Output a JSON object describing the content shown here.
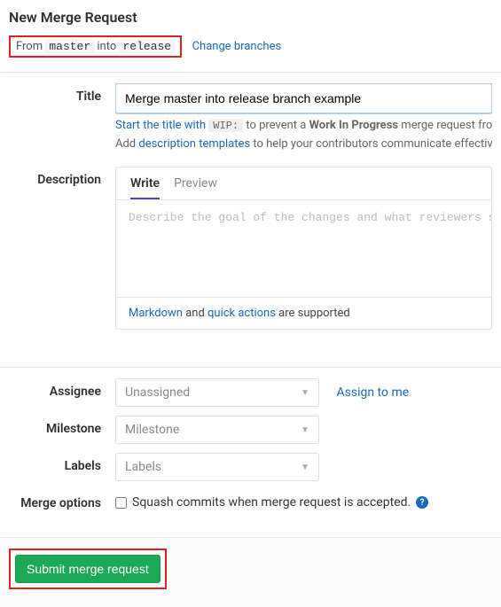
{
  "page_title": "New Merge Request",
  "branch_info": {
    "prefix": "From ",
    "source": "master",
    "mid": " into ",
    "target": "release"
  },
  "change_branches": "Change branches",
  "labels": {
    "title": "Title",
    "description": "Description",
    "assignee": "Assignee",
    "milestone": "Milestone",
    "labels_f": "Labels",
    "merge_options": "Merge options"
  },
  "title_value": "Merge master into release branch example",
  "hint1": {
    "a": "Start the title with ",
    "wip": "WIP:",
    "b": " to prevent a ",
    "wip_bold": "Work In Progress",
    "c": " merge request from be"
  },
  "hint2": {
    "a": "Add ",
    "link": "description templates",
    "b": " to help your contributors communicate effectively!"
  },
  "desc_tabs": {
    "write": "Write",
    "preview": "Preview"
  },
  "desc_placeholder": "Describe the goal of the changes and what reviewers should be ",
  "desc_footer": {
    "a": "Markdown",
    "b": " and ",
    "c": "quick actions",
    "d": " are supported"
  },
  "selects": {
    "assignee": "Unassigned",
    "milestone": "Milestone",
    "labels": "Labels"
  },
  "assign_to_me": "Assign to me",
  "squash_label": "Squash commits when merge request is accepted.",
  "help_char": "?",
  "submit_label": "Submit merge request"
}
